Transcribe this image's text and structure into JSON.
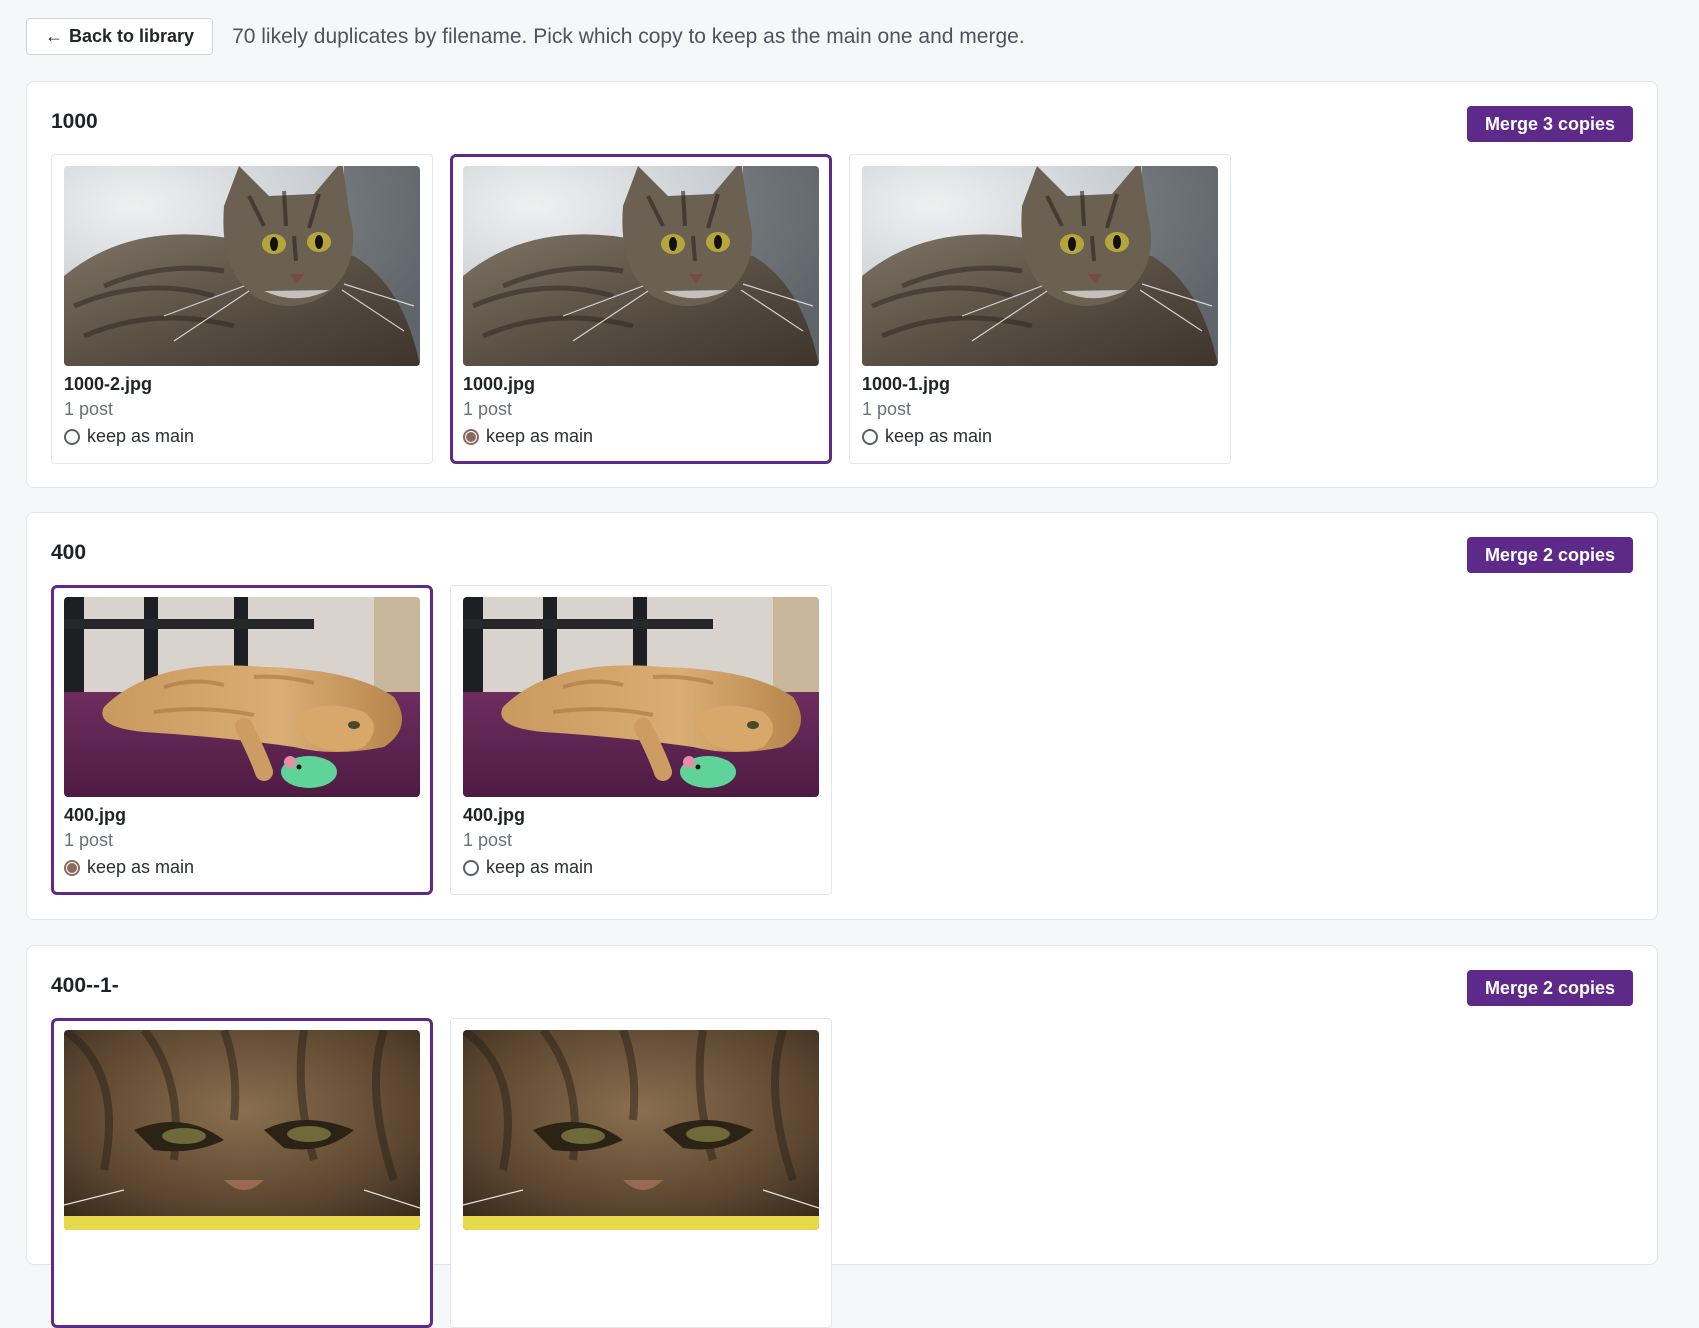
{
  "header": {
    "back_label": "Back to library",
    "back_arrow": "←",
    "intro_text": "70 likely duplicates by filename. Pick which copy to keep as the main one and merge."
  },
  "groups": [
    {
      "title": "1000",
      "merge_label": "Merge 3 copies",
      "cards": [
        {
          "filename": "1000-2.jpg",
          "posts": "1 post",
          "keep_label": "keep as main",
          "selected": false,
          "image": "tabby-cat-lying"
        },
        {
          "filename": "1000.jpg",
          "posts": "1 post",
          "keep_label": "keep as main",
          "selected": true,
          "image": "tabby-cat-lying"
        },
        {
          "filename": "1000-1.jpg",
          "posts": "1 post",
          "keep_label": "keep as main",
          "selected": false,
          "image": "tabby-cat-lying"
        }
      ]
    },
    {
      "title": "400",
      "merge_label": "Merge 2 copies",
      "cards": [
        {
          "filename": "400.jpg",
          "posts": "1 post",
          "keep_label": "keep as main",
          "selected": true,
          "image": "ginger-cat-with-toy-mouse"
        },
        {
          "filename": "400.jpg",
          "posts": "1 post",
          "keep_label": "keep as main",
          "selected": false,
          "image": "ginger-cat-with-toy-mouse"
        }
      ]
    },
    {
      "title": "400--1-",
      "merge_label": "Merge 2 copies",
      "cards": [
        {
          "image": "tabby-cat-closeup",
          "selected": true
        },
        {
          "image": "tabby-cat-closeup",
          "selected": false
        }
      ]
    }
  ],
  "colors": {
    "accent": "#5e2a8a",
    "radio_selected": "#8a6a5c",
    "page_background": "#f6f7f9"
  }
}
